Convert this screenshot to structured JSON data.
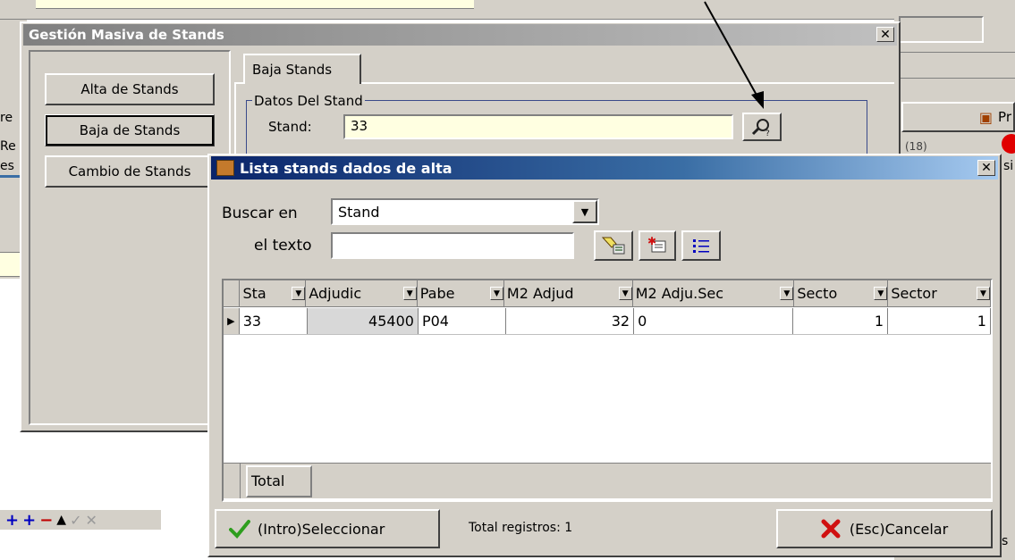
{
  "outer_window": {
    "title": "Gestión Masiva de Stands",
    "close_glyph": "✕",
    "side_buttons": [
      "Alta de Stands",
      "Baja de Stands",
      "Cambio de Stands"
    ],
    "tab_label": "Baja Stands",
    "group_label": "Datos Del Stand",
    "stand_label": "Stand:",
    "stand_value": "33"
  },
  "background": {
    "frag_pr": "Pr",
    "frag_re": "re",
    "frag_re2": "Re",
    "frag_es": "es",
    "frag_si": "si",
    "frag_s": "s",
    "frag_18": "(18)",
    "toolbar_glyphs": [
      "+",
      "+",
      "−",
      "▲",
      "✓",
      "✕"
    ]
  },
  "dialog": {
    "title": "Lista stands dados de alta",
    "close_glyph": "✕",
    "buscar_label": "Buscar en",
    "buscar_value": "Stand",
    "texto_label": "el texto",
    "texto_value": "",
    "columns": [
      "Sta",
      "Adjudic",
      "Pabe",
      "M2 Adjud",
      "M2 Adju.Sec",
      "Secto",
      "Sector"
    ],
    "rows": [
      [
        "33",
        "45400",
        "P04",
        "32",
        "0",
        "1",
        "1"
      ]
    ],
    "total_label": "Total",
    "select_button": "(Intro)Seleccionar",
    "total_registros": "Total registros: 1",
    "cancel_button": "(Esc)Cancelar"
  },
  "icons": {
    "search": "search-icon",
    "flashlight": "flashlight-filter-icon",
    "clear": "clear-filter-icon",
    "list": "list-icon",
    "check": "checkmark-icon",
    "cancel": "cancel-x-icon"
  },
  "colors": {
    "window_bg": "#d4d0c8",
    "dialog_title": "#0a246a",
    "stand_field_bg": "#ffffe1",
    "check_green": "#2e9e1e",
    "cancel_red": "#d01010"
  }
}
